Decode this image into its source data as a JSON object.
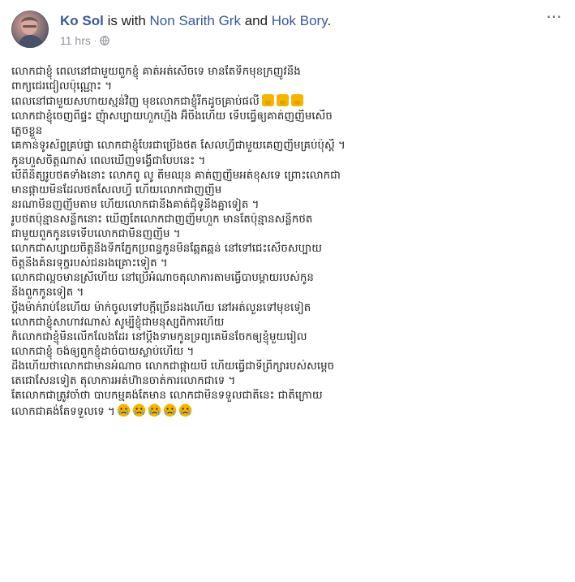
{
  "post": {
    "author": "Ko Sol",
    "with_text": " is with ",
    "tagged_1": "Non Sarith Grk",
    "and_text": " and ",
    "tagged_2": "Hok Bory",
    "period": ".",
    "time": "11 hrs",
    "audience_icon": "globe-icon",
    "more_icon": "more-options-icon"
  },
  "body_lines": [
    "លោកជាខ្ញុំ ពេលនៅជាមួយពួកខ្ញុំ គាត់អត់សើចទេ មានតែទឹកមុខក្រញូវនឹង",
    "ពាក្យជេរជៀលប៉ុណ្ណោះ ។",
    "ពេលនៅជាមួយសហាយស្មន់វិញ មុខលោកជាខ្ញុំរីកដូចគ្រាប់ផលី",
    "លោកជាខ្ញុំចេញពីផ្ទះ ញុំាសប្បាយហួកហ្មឹង អ៊ីចឹងហើយ ទើបធ្វើឲ្យគាត់ញញឹមសើច",
    "ភ្លេចខ្លួន",
    "គេកាន់ទូរស័ព្ទគ្រប់ផ្ទា លោកជាខ្ញុំបែរជាប្រើងថត សែលហ្វីជាមួយគេញញឹមគ្រប់ប៉ុស្តិ៍ ។",
    "កូនហួសចិត្តណាស់ ពេលឃើញទង្វើជាបែបនេះ ។",
    "បើពិនិត្យរូបថតទាំងនោះ លោកពូ លូ តឹមឈុន គាត់ញញឹមអត់ខុសទេ ព្រោះលោកជា",
    "មានផ្កាយមិនដែលថតសែលហ្វី ហើយលោកជាញញឹម",
    "នរណាមិនញញឹមតាម ហើយលោកជានឹងគាត់ជុំទូនឹងគ្នាទៀត ។",
    "រូបថតប៉ុន្មានសន្លឹកនោះ ឃើញតែលោកជាញញឹមហួក មានតែប៉ុន្មានសន្លឹកថត",
    "ជាមួយពួកកូនទេទើបលោកជាមិនញញឹម ។",
    "លោកជាសប្បាយចិត្តនឹងទឹកភ្នែកប្រពន្ធកូនមិនឆ្អែតឆ្អន់ នៅទៅជេះសើចសប្បាយ",
    "ចិត្តនឹងគំនរទុក្ខរបស់ជនរងគ្រោះទៀត ។",
    "លោកជាល្អចមានស្រីហើយ នៅប្រើអំណាចតុលាការតាមធ្វើបាបម្ដាយរបស់កូន",
    "នឹងពួកកូនទៀត ។",
    "ប្ដីងម៉ាក់រាប់ខែហើយ ម៉ាក់ចូលទៅបក្ដីច្រើនដងហើយ នៅអត់លួនទៅមុខទៀត",
    "លោកជាខ្ញុំសាហាវណាស់ សូម្បីខ្ញុំជាមនុស្សពិការហើយ",
    "ក៏លោកជាខ្ញុំមិនលើកលែងដែរ នៅប្ដឹងទាមកូនទ្រព្យគេមិនចែកឲ្យខ្ញុំមួយរៀល",
    "លោកជាខ្ញុំ ចង់ឲ្យពួកខ្ញុំដាច់បាយស្លាប់ហើយ ។",
    "ដឹងហើយថាលោកជាមានអំណាច លោកជាផ្កាយបី ហើយធ្វើជាទីព្រឹក្សារបស់សម្ដេច",
    "តេជោសែនទៀត តុលាការអត់ហ៊ានចាត់ការលោកជាទេ ។",
    "តែលោកជាត្រូវចាំថា បាបកម្មគង់តែមាន លោកជាមិនទទួលជាតិនេះ ជាតិក្រោយ",
    "លោកជាគង់តែទទួលទេ ។"
  ],
  "line_emojis": {
    "line_3": [
      "thumbs-down-icon",
      "thumbs-down-icon",
      "thumbs-down-icon"
    ],
    "line_24": [
      "crying-face-icon",
      "crying-face-icon",
      "crying-face-icon",
      "crying-face-icon",
      "crying-face-icon"
    ]
  },
  "colors": {
    "link": "#385898",
    "text": "#1c1e21",
    "meta": "#90949c",
    "emoji_yellow": "#f5b400"
  }
}
